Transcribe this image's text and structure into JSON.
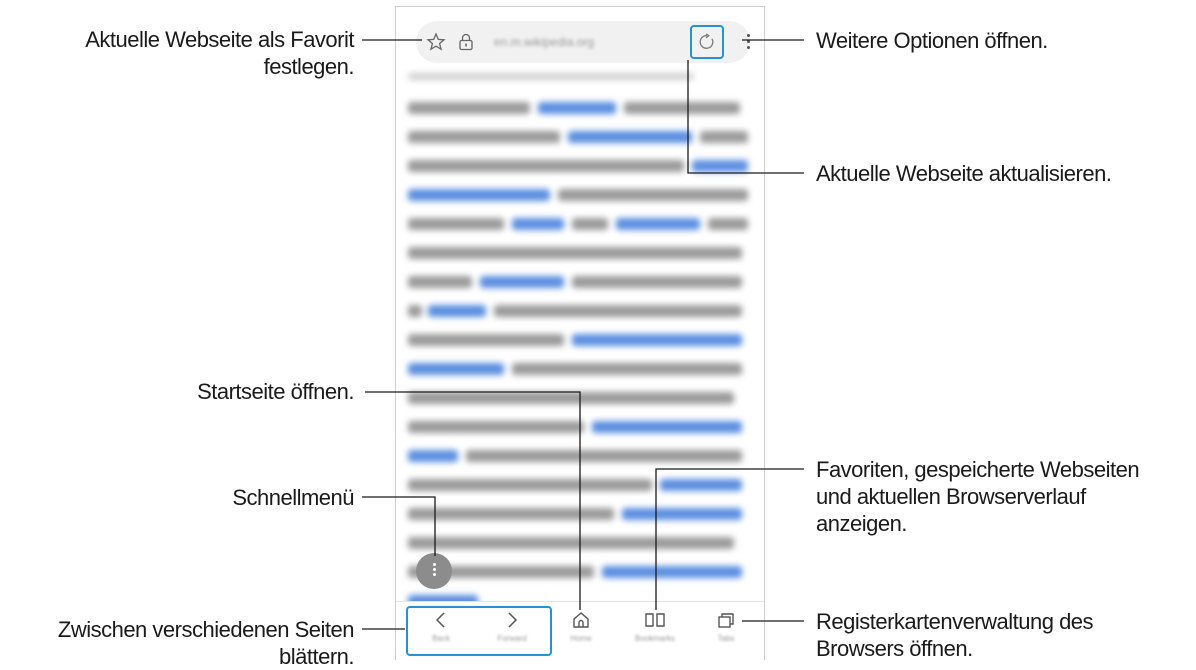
{
  "phone": {
    "url_text": "en.m.wikipedia.org",
    "nav": {
      "back_label": "Back",
      "forward_label": "Forward",
      "home_label": "Home",
      "bookmarks_label": "Bookmarks",
      "tabs_label": "Tabs"
    },
    "icons": [
      "star-icon",
      "lock-icon",
      "refresh-icon",
      "more-options-icon",
      "quick-menu-icon",
      "back-arrow-icon",
      "forward-arrow-icon",
      "home-icon",
      "bookmarks-icon",
      "tabs-icon"
    ]
  },
  "callouts": {
    "favorite": [
      "Aktuelle Webseite als Favorit",
      "festlegen."
    ],
    "more_options": "Weitere Optionen öffnen.",
    "refresh": "Aktuelle Webseite aktualisieren.",
    "home": "Startseite öffnen.",
    "bookmarks": [
      "Favoriten, gespeicherte Webseiten",
      "und aktuellen Browserverlauf",
      "anzeigen."
    ],
    "quick_menu": "Schnellmenü",
    "navigate": [
      "Zwischen verschiedenen Seiten",
      "blättern."
    ],
    "tabs": [
      "Registerkartenverwaltung des",
      "Browsers öffnen."
    ]
  },
  "colors": {
    "highlight": "#2a8fd6",
    "leader_line": "#1a1a1a",
    "link_text": "#5a8ee0"
  }
}
